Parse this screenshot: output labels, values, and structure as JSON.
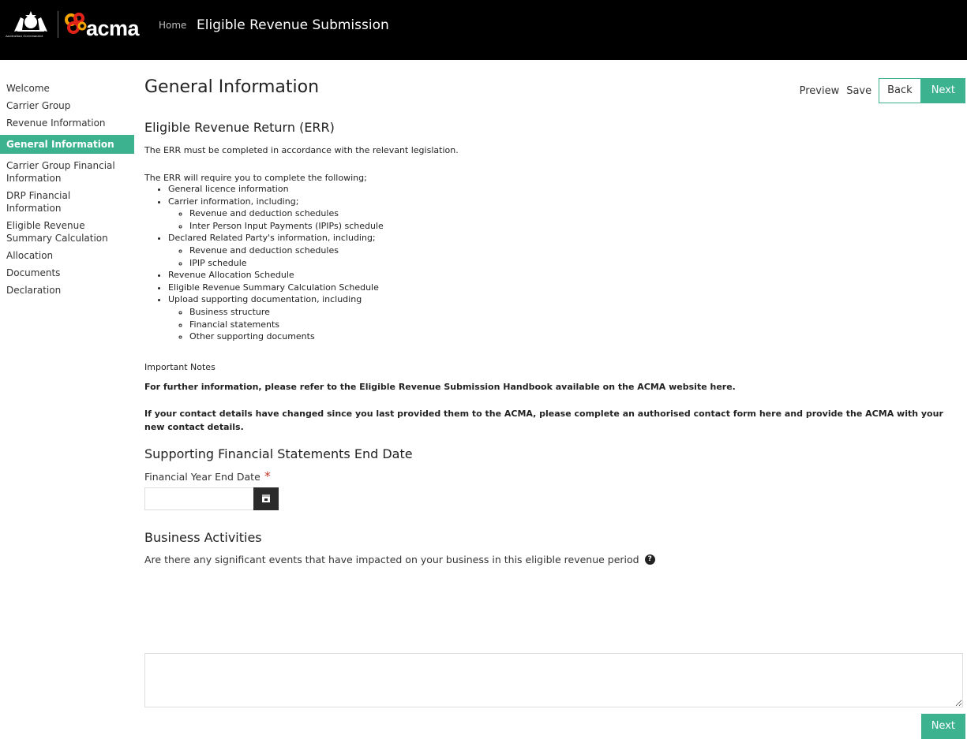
{
  "header": {
    "crest_caption": "Australian Government",
    "logo_text": "acma",
    "home_label": "Home",
    "app_title": "Eligible Revenue Submission"
  },
  "sidebar": {
    "items": [
      {
        "label": "Welcome",
        "active": false
      },
      {
        "label": "Carrier Group",
        "active": false
      },
      {
        "label": "Revenue Information",
        "active": false
      },
      {
        "label": "General Information",
        "active": true
      },
      {
        "label": "Carrier Group Financial Information",
        "active": false
      },
      {
        "label": "DRP Financial Information",
        "active": false
      },
      {
        "label": "Eligible Revenue Summary Calculation",
        "active": false
      },
      {
        "label": "Allocation",
        "active": false
      },
      {
        "label": "Documents",
        "active": false
      },
      {
        "label": "Declaration",
        "active": false
      }
    ]
  },
  "page": {
    "title": "General Information",
    "actions": {
      "preview": "Preview",
      "save": "Save",
      "back": "Back",
      "next": "Next"
    }
  },
  "err": {
    "heading": "Eligible Revenue Return (ERR)",
    "intro": "The ERR must be completed in accordance with the relevant legislation.",
    "list_intro": "The ERR will require you to complete the following;",
    "items": [
      {
        "text": "General licence information",
        "sub": []
      },
      {
        "text": "Carrier information, including;",
        "sub": [
          "Revenue and deduction schedules",
          "Inter Person Input Payments (IPIPs) schedule"
        ]
      },
      {
        "text": "Declared Related Party's information, including;",
        "sub": [
          "Revenue and deduction schedules",
          "IPIP schedule"
        ]
      },
      {
        "text": "Revenue Allocation Schedule",
        "sub": []
      },
      {
        "text": "Eligible Revenue Summary Calculation Schedule",
        "sub": []
      },
      {
        "text": "Upload supporting documentation, including",
        "sub": [
          "Business structure",
          "Financial statements",
          "Other supporting documents"
        ]
      }
    ],
    "notes_label": "Important Notes",
    "note1": "For further information, please refer to the Eligible Revenue Submission Handbook available on the ACMA website here.",
    "note2": "If your contact details have changed since you last provided them to the ACMA, please complete an authorised contact form here and provide the ACMA with your new contact details."
  },
  "statements": {
    "heading": "Supporting Financial Statements End Date",
    "date_label": "Financial Year End Date",
    "required_mark": "*",
    "date_value": "",
    "calendar_icon": "calendar-icon"
  },
  "business": {
    "heading": "Business Activities",
    "question": "Are there any significant events that have impacted on your business in this eligible revenue period",
    "help_glyph": "?",
    "answer": ""
  },
  "footer": {
    "next": "Next"
  },
  "colors": {
    "accent": "#3cb28e",
    "header_bg": "#000000",
    "required": "#c0392b"
  }
}
